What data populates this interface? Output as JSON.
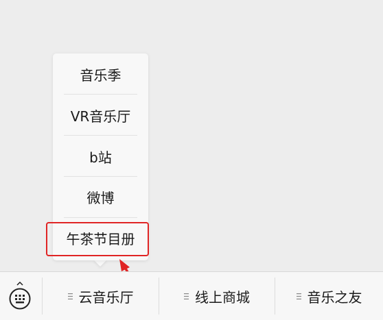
{
  "popup_menu": {
    "items": [
      {
        "label": "音乐季"
      },
      {
        "label": "VR音乐厅"
      },
      {
        "label": "b站"
      },
      {
        "label": "微博"
      },
      {
        "label": "午茶节目册"
      }
    ],
    "highlighted_item_index": 4
  },
  "bottom_menu": {
    "keyboard_icon": "keyboard-icon",
    "tabs": [
      {
        "label": "云音乐厅",
        "icon": "submenu-icon"
      },
      {
        "label": "线上商城",
        "icon": "submenu-icon"
      },
      {
        "label": "音乐之友",
        "icon": "submenu-icon"
      }
    ]
  },
  "annotation_color": "#e02424"
}
